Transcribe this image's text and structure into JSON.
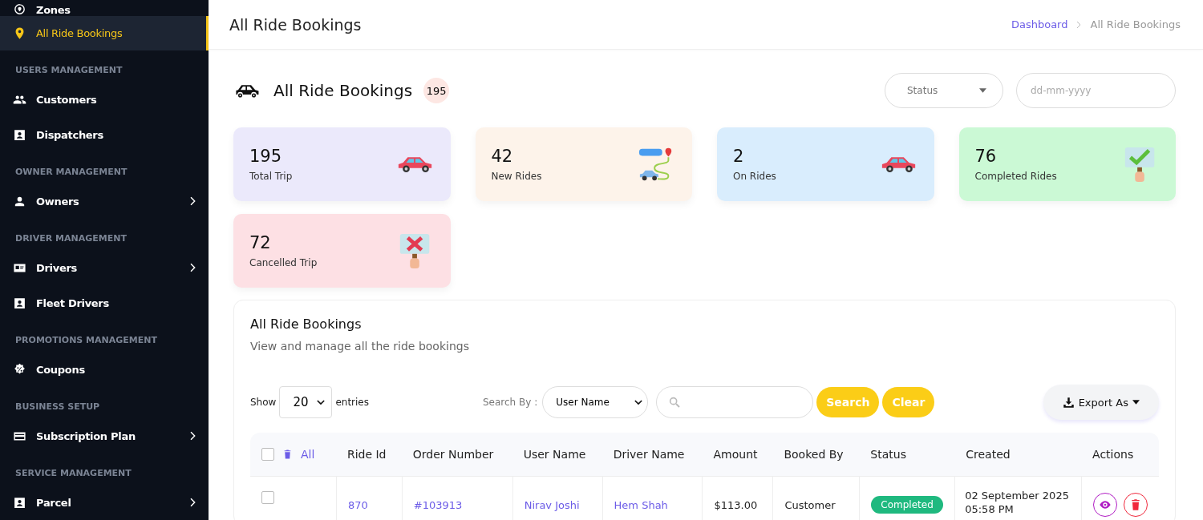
{
  "sidebar": {
    "items": [
      {
        "kind": "item",
        "label": "Zones",
        "selected": false,
        "expandable": false
      },
      {
        "kind": "item",
        "label": "All Ride Bookings",
        "selected": true,
        "expandable": false
      },
      {
        "kind": "section",
        "label": "USERS MANAGEMENT"
      },
      {
        "kind": "item",
        "label": "Customers",
        "selected": false,
        "expandable": false
      },
      {
        "kind": "item",
        "label": "Dispatchers",
        "selected": false,
        "expandable": false
      },
      {
        "kind": "section",
        "label": "OWNER MANAGEMENT"
      },
      {
        "kind": "item",
        "label": "Owners",
        "selected": false,
        "expandable": true
      },
      {
        "kind": "section",
        "label": "DRIVER MANAGEMENT"
      },
      {
        "kind": "item",
        "label": "Drivers",
        "selected": false,
        "expandable": true
      },
      {
        "kind": "item",
        "label": "Fleet Drivers",
        "selected": false,
        "expandable": false
      },
      {
        "kind": "section",
        "label": "PROMOTIONS MANAGEMENT"
      },
      {
        "kind": "item",
        "label": "Coupons",
        "selected": false,
        "expandable": false
      },
      {
        "kind": "section",
        "label": "BUSINESS SETUP"
      },
      {
        "kind": "item",
        "label": "Subscription Plan",
        "selected": false,
        "expandable": true
      },
      {
        "kind": "section",
        "label": "SERVICE MANAGEMENT"
      },
      {
        "kind": "item",
        "label": "Parcel",
        "selected": false,
        "expandable": true
      }
    ]
  },
  "header": {
    "title": "All Ride Bookings",
    "breadcrumb": [
      "Dashboard",
      "All Ride Bookings"
    ]
  },
  "summary": {
    "title": "All Ride Bookings",
    "count": "195",
    "status_filter": {
      "placeholder": "Status"
    },
    "date_filter": {
      "placeholder": "dd-mm-yyyy"
    }
  },
  "stats": [
    {
      "value": "195",
      "label": "Total Trip",
      "color": "#ebe9fb"
    },
    {
      "value": "42",
      "label": "New Rides",
      "color": "#fdf3ea"
    },
    {
      "value": "2",
      "label": "On Rides",
      "color": "#d9edfd"
    },
    {
      "value": "76",
      "label": "Completed Rides",
      "color": "#cbf9d5"
    },
    {
      "value": "72",
      "label": "Cancelled Trip",
      "color": "#fde0e4"
    }
  ],
  "panel": {
    "title": "All Ride Bookings",
    "subtitle": "View and manage all the ride bookings",
    "show_label": "Show",
    "page_size": "20",
    "entries_label": "entries",
    "search_by_label": "Search By :",
    "search_by": "User Name",
    "search_button": "Search",
    "clear_button": "Clear",
    "export_button": "Export As"
  },
  "table": {
    "select_all": {
      "label": "All",
      "checked": false
    },
    "columns": [
      "Ride Id",
      "Order Number",
      "User Name",
      "Driver Name",
      "Amount",
      "Booked By",
      "Status",
      "Created",
      "Actions"
    ],
    "rows": [
      {
        "checked": false,
        "ride_id": "870",
        "order_number": "#103913",
        "user_name": "Nirav Joshi",
        "driver_name": "Hem Shah",
        "amount": "$113.00",
        "booked_by": "Customer",
        "status": "Completed",
        "created": [
          "02 September 2025",
          "05:58 PM"
        ]
      }
    ]
  }
}
